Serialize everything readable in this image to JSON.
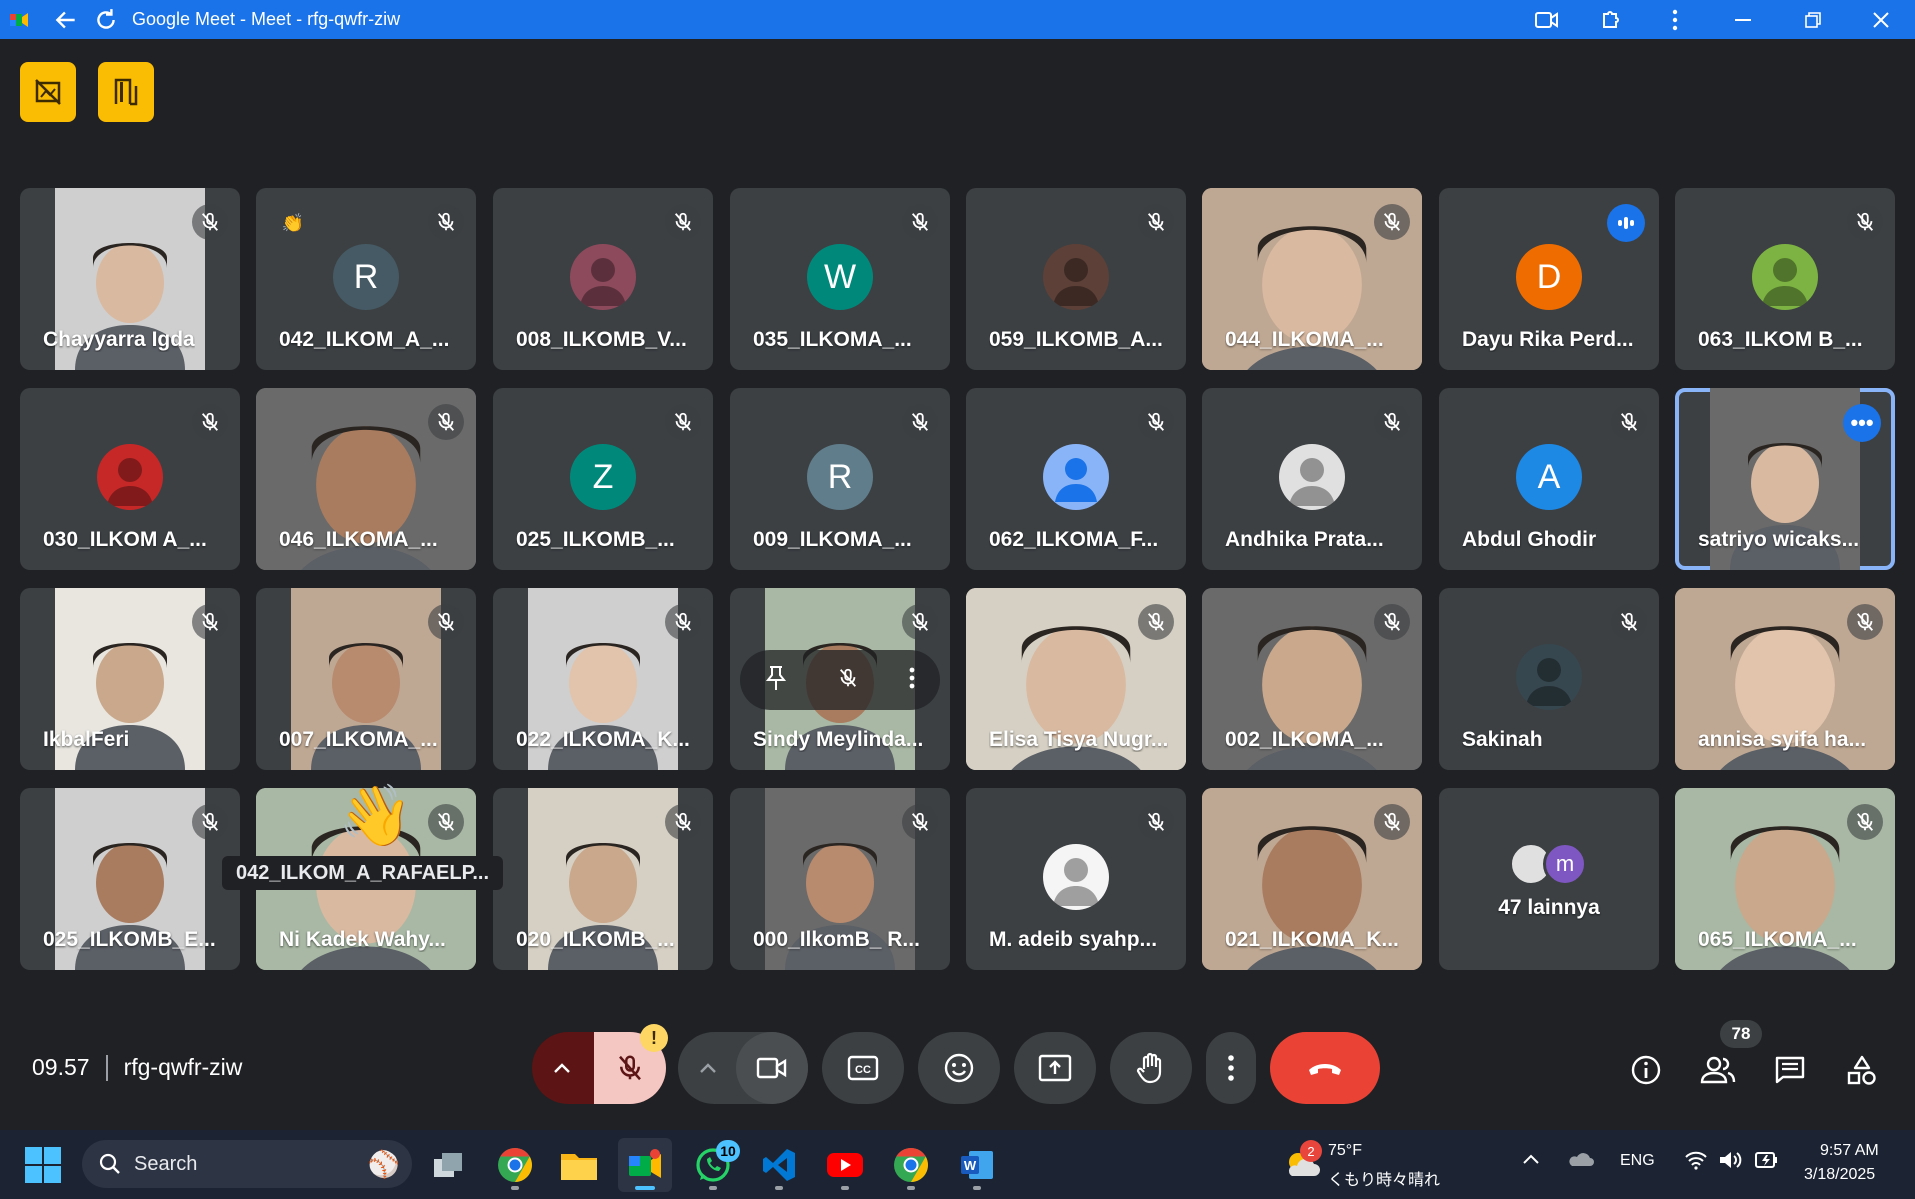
{
  "window": {
    "title": "Google Meet - Meet - rfg-qwfr-ziw"
  },
  "colors": {
    "titlebar": "#1a73e8",
    "background": "#202124",
    "tile": "#3c4043",
    "accent_yellow": "#fbbc04",
    "end_call_red": "#ea4335",
    "muted_pink": "#f4c7c3",
    "active_border": "#8ab4f8"
  },
  "participants": [
    {
      "name": "Chayyarra Igda",
      "type": "video",
      "muted": true,
      "icon": "mic-off-icon"
    },
    {
      "name": "042_ILKOM_A_...",
      "type": "avatar",
      "letter": "R",
      "avatar_color": "#455a64",
      "muted": true,
      "reaction": "clap-icon"
    },
    {
      "name": "008_ILKOMB_V...",
      "type": "photo-avatar",
      "avatar_color": "#8d4a5c",
      "muted": true
    },
    {
      "name": "035_ILKOMA_...",
      "type": "avatar",
      "letter": "W",
      "avatar_color": "#00897b",
      "muted": true
    },
    {
      "name": "059_ILKOMB_A...",
      "type": "photo-avatar",
      "avatar_color": "#5d4037",
      "muted": true
    },
    {
      "name": "044_ILKOMA_...",
      "type": "video",
      "muted": true
    },
    {
      "name": "Dayu Rika Perd...",
      "type": "avatar",
      "letter": "D",
      "avatar_color": "#ef6c00",
      "muted": false,
      "speaking": true
    },
    {
      "name": "063_ILKOM B_...",
      "type": "photo-avatar",
      "avatar_color": "#7cb342",
      "muted": true
    },
    {
      "name": "030_ILKOM A_...",
      "type": "photo-avatar",
      "avatar_color": "#c62828",
      "muted": true
    },
    {
      "name": "046_ILKOMA_...",
      "type": "video",
      "muted": true
    },
    {
      "name": "025_ILKOMB_...",
      "type": "avatar",
      "letter": "Z",
      "avatar_color": "#00897b",
      "muted": true
    },
    {
      "name": "009_ILKOMA_...",
      "type": "avatar",
      "letter": "R",
      "avatar_color": "#607d8b",
      "muted": true
    },
    {
      "name": "062_ILKOMA_F...",
      "type": "person-avatar",
      "avatar_color": "#8ab4f8",
      "muted": true
    },
    {
      "name": "Andhika Prata...",
      "type": "photo-avatar",
      "avatar_color": "#e0e0e0",
      "muted": true
    },
    {
      "name": "Abdul Ghodir",
      "type": "avatar",
      "letter": "A",
      "avatar_color": "#1e88e5",
      "muted": true
    },
    {
      "name": "satriyo wicaks...",
      "type": "video",
      "muted": false,
      "active": true
    },
    {
      "name": "IkbalFeri",
      "type": "video",
      "muted": true
    },
    {
      "name": "007_ILKOMA_...",
      "type": "video",
      "muted": true
    },
    {
      "name": "022_ILKOMA_K...",
      "type": "video",
      "muted": true
    },
    {
      "name": "Sindy Meylinda...",
      "type": "video",
      "muted": true,
      "hover": true
    },
    {
      "name": "Elisa Tisya Nugr...",
      "type": "video",
      "muted": true
    },
    {
      "name": "002_ILKOMA_...",
      "type": "video",
      "muted": true
    },
    {
      "name": "Sakinah",
      "type": "photo-avatar",
      "avatar_color": "#37474f",
      "muted": true
    },
    {
      "name": "annisa syifa ha...",
      "type": "video",
      "muted": true
    },
    {
      "name": "025_ILKOMB_E...",
      "type": "video",
      "muted": true
    },
    {
      "name": "Ni Kadek Wahy...",
      "type": "video",
      "muted": true
    },
    {
      "name": "020_ILKOMB_...",
      "type": "video",
      "muted": true
    },
    {
      "name": "000_IlkomB_ R...",
      "type": "video",
      "muted": true
    },
    {
      "name": "M. adeib syahp...",
      "type": "photo-avatar",
      "avatar_color": "#f5f5f5",
      "muted": true
    },
    {
      "name": "021_ILKOMA_K...",
      "type": "video",
      "muted": true
    },
    {
      "name": "47 lainnya",
      "type": "others",
      "letter": "m",
      "avatar_color": "#7e57c2"
    },
    {
      "name": "065_ILKOMA_...",
      "type": "video",
      "muted": true
    }
  ],
  "tooltip": "042_ILKOM_A_RAFAELP...",
  "meeting": {
    "time": "09.57",
    "code": "rfg-qwfr-ziw",
    "people_count": "78",
    "mic_warning": "!"
  },
  "taskbar": {
    "search_placeholder": "Search",
    "weather_temp": "75°F",
    "weather_desc": "くもり時々晴れ",
    "weather_badge": "2",
    "whatsapp_badge": "10",
    "language": "ENG",
    "clock_time": "9:57 AM",
    "clock_date": "3/18/2025"
  }
}
